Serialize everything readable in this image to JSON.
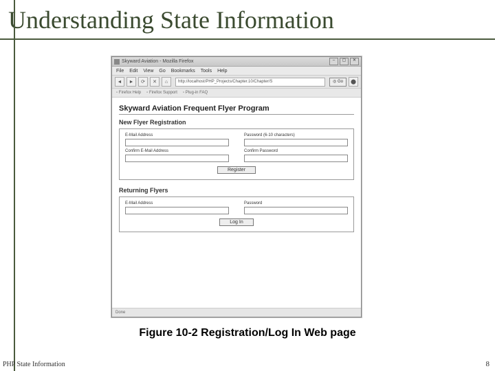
{
  "slide": {
    "title": "Understanding State Information",
    "caption": "Figure 10-2 Registration/Log In Web page",
    "footer_left": "PHP State Information",
    "footer_right": "8"
  },
  "browser": {
    "title": "Skyward Aviation - Mozilla Firefox",
    "menu": [
      "File",
      "Edit",
      "View",
      "Go",
      "Bookmarks",
      "Tools",
      "Help"
    ],
    "nav": {
      "back": "◄",
      "forward": "►",
      "reload": "⟳",
      "stop": "✕",
      "home": "⌂"
    },
    "address": "http://localhost/PHP_Projects/Chapter.10/Chapter/S",
    "go_label": "Go",
    "bookmarks": [
      "Firefox Help",
      "Firefox Support",
      "Plug-in FAQ"
    ],
    "status": "Done"
  },
  "page": {
    "heading": "Skyward Aviation Frequent Flyer Program",
    "section_new": "New Flyer Registration",
    "section_returning": "Returning Flyers",
    "labels": {
      "email": "E-Mail Address",
      "password_new": "Password (6-10 characters)",
      "confirm_email": "Confirm E-Mail Address",
      "confirm_password": "Confirm Password",
      "password": "Password"
    },
    "buttons": {
      "register": "Register",
      "login": "Log In"
    }
  }
}
